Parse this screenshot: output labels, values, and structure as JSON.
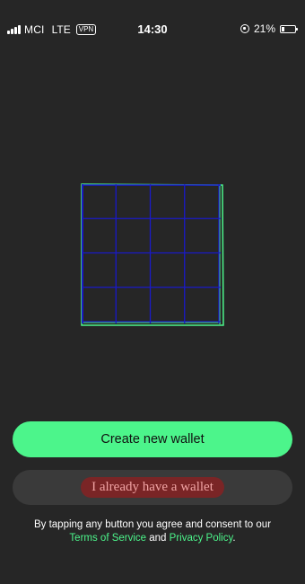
{
  "status_bar": {
    "carrier": "MCI",
    "network": "LTE",
    "vpn": "VPN",
    "time": "14:30",
    "battery": "21%",
    "battery_level": 0.21
  },
  "illustration": {
    "icon": "wallet-grid-icon",
    "grid_rows": 4,
    "grid_cols": 4,
    "colors": {
      "grid_lines": "#1a1ac8",
      "outline": "#4cf58b"
    }
  },
  "actions": {
    "create_label": "Create new wallet",
    "existing_label": "I already have a wallet"
  },
  "consent": {
    "prefix": "By tapping any button you agree and consent to our",
    "terms": "Terms of Service",
    "and": "and",
    "privacy": "Privacy Policy",
    "suffix": "."
  },
  "colors": {
    "background": "#262626",
    "accent": "#4cf58b",
    "secondary_button": "#3a3a3a",
    "highlight": "#7a2526"
  }
}
